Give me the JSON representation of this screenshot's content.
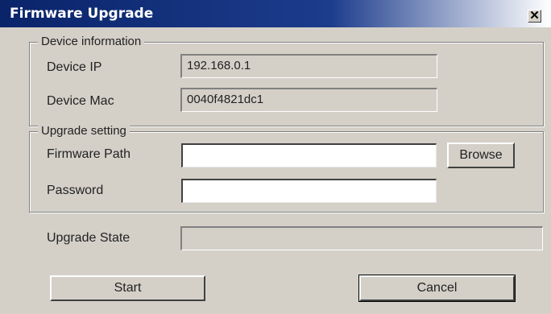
{
  "window": {
    "title": "Firmware Upgrade",
    "close_label": "✕"
  },
  "device_info": {
    "legend": "Device information",
    "ip_label": "Device IP",
    "ip_value": "192.168.0.1",
    "mac_label": "Device Mac",
    "mac_value": "0040f4821dc1"
  },
  "upgrade_setting": {
    "legend": "Upgrade setting",
    "path_label": "Firmware Path",
    "path_value": "",
    "browse_label": "Browse",
    "password_label": "Password",
    "password_value": ""
  },
  "upgrade_state": {
    "label": "Upgrade State",
    "value": ""
  },
  "actions": {
    "start_label": "Start",
    "cancel_label": "Cancel"
  }
}
